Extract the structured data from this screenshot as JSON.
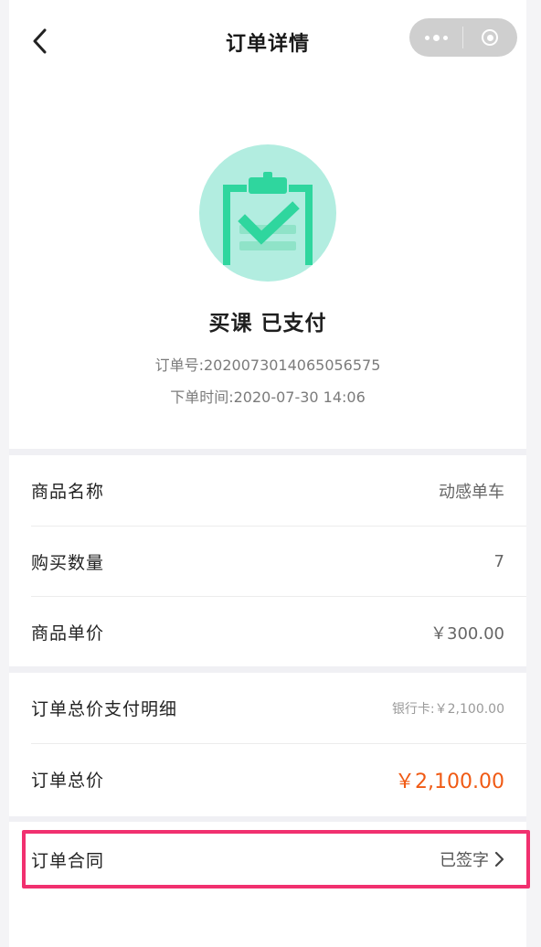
{
  "nav": {
    "title": "订单详情",
    "back_icon": "chevron-left-icon",
    "menu_icon": "more-dots-icon",
    "close_icon": "target-circle-icon"
  },
  "status": {
    "icon": "clipboard-check-icon",
    "icon_bg_color": "#b2ede0",
    "icon_fg_color": "#2fd69e",
    "title": "买课 已支付",
    "order_no": "订单号:2020073014065056575",
    "order_time": "下单时间:2020-07-30 14:06"
  },
  "details": [
    {
      "label": "商品名称",
      "value": "动感单车"
    },
    {
      "label": "购买数量",
      "value": "7"
    },
    {
      "label": "商品单价",
      "value": "￥300.00"
    }
  ],
  "payment": {
    "detail_label": "订单总价支付明细",
    "detail_value": "银行卡:￥2,100.00",
    "total_label": "订单总价",
    "total_value": "￥2,100.00",
    "total_color": "#f05a14"
  },
  "contract": {
    "label": "订单合同",
    "value": "已签字",
    "arrow_icon": "chevron-right-icon",
    "highlight_color": "#f1306f"
  }
}
